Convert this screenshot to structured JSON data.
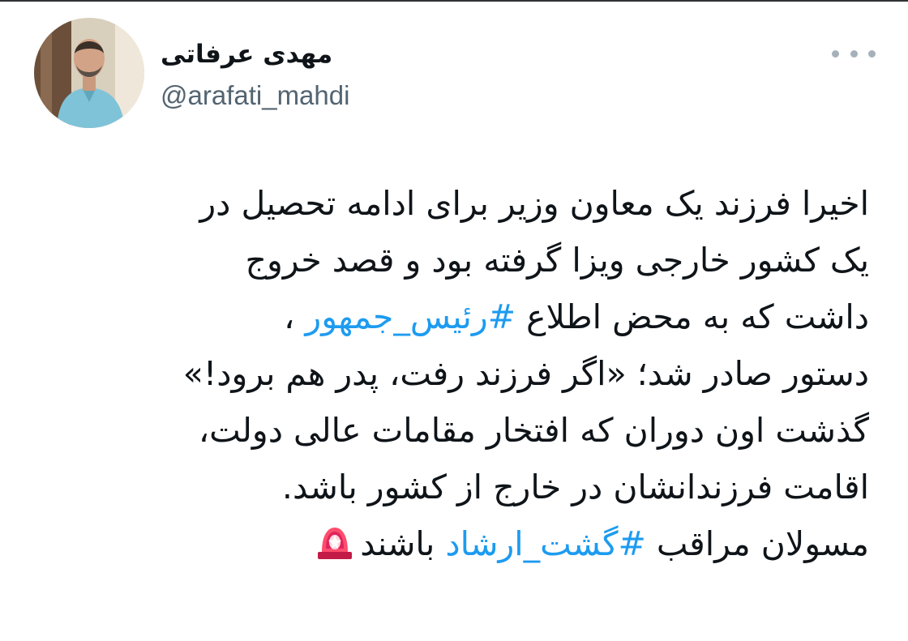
{
  "user": {
    "display_name": "مهدی عرفاتی",
    "handle": "@arafati_mahdi"
  },
  "menu": {
    "icon": "more-horizontal-icon"
  },
  "tweet": {
    "line1": "اخیرا فرزند یک معاون وزیر برای ادامه تحصیل در",
    "line2": "یک کشور خارجی ویزا گرفته بود و قصد خروج",
    "line3_a": "داشت که به محض اطلاع ",
    "hashtag1": "#رئیس_جمهور",
    "line3_b": " ،",
    "line4": "دستور صادر شد؛ «اگر فرزند رفت، پدر هم برود!»",
    "line5": "گذشت اون دوران که افتخار مقامات عالی دولت،",
    "line6": "اقامت فرزندانشان در خارج از کشور باشد.",
    "line7_a": "مسولان مراقب ",
    "hashtag2": "#گشت_ارشاد",
    "line7_b": " باشند",
    "emoji": "police-siren-icon"
  },
  "colors": {
    "text": "#0f1419",
    "secondary": "#536471",
    "link": "#1d9bf0",
    "siren": "#e0245e"
  }
}
